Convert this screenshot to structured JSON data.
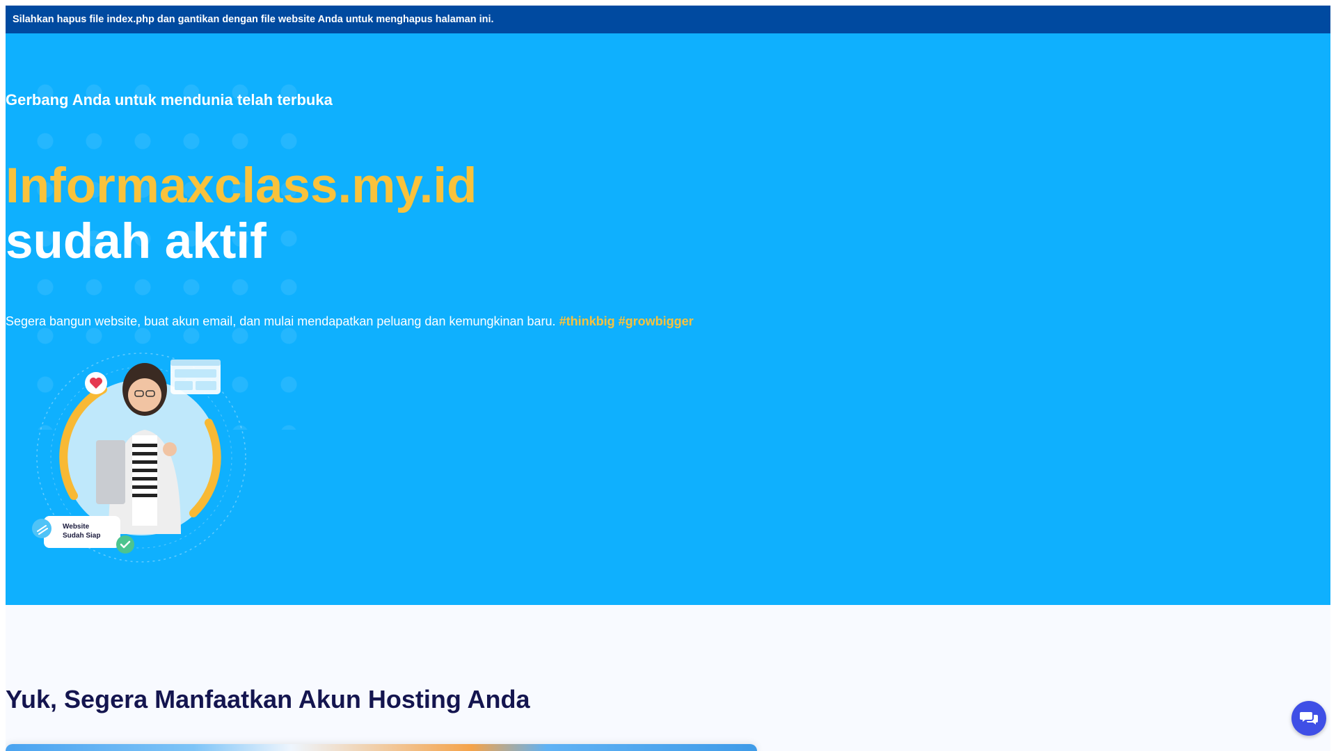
{
  "notice_bar": {
    "text": "Silahkan hapus file index.php dan gantikan dengan file website Anda untuk menghapus halaman ini."
  },
  "hero": {
    "subheading": "Gerbang Anda untuk mendunia telah terbuka",
    "domain": "Informaxclass.my.id",
    "status": "sudah aktif",
    "description": "Segera bangun website, buat akun email, dan mulai mendapatkan peluang dan kemungkinan baru.",
    "hashtags": "#thinkbig #growbigger",
    "illustration": {
      "badge_line1": "Website",
      "badge_line2": "Sudah Siap"
    }
  },
  "section": {
    "title": "Yuk, Segera Manfaatkan Akun Hosting Anda"
  },
  "chat_widget": {
    "icon": "chat-bubbles-icon"
  },
  "colors": {
    "notice_bg": "#004aa0",
    "hero_bg": "#0fb0fe",
    "accent_yellow": "#f9c23c",
    "heading_navy": "#14154f",
    "chat_button": "#3f4fe6"
  }
}
